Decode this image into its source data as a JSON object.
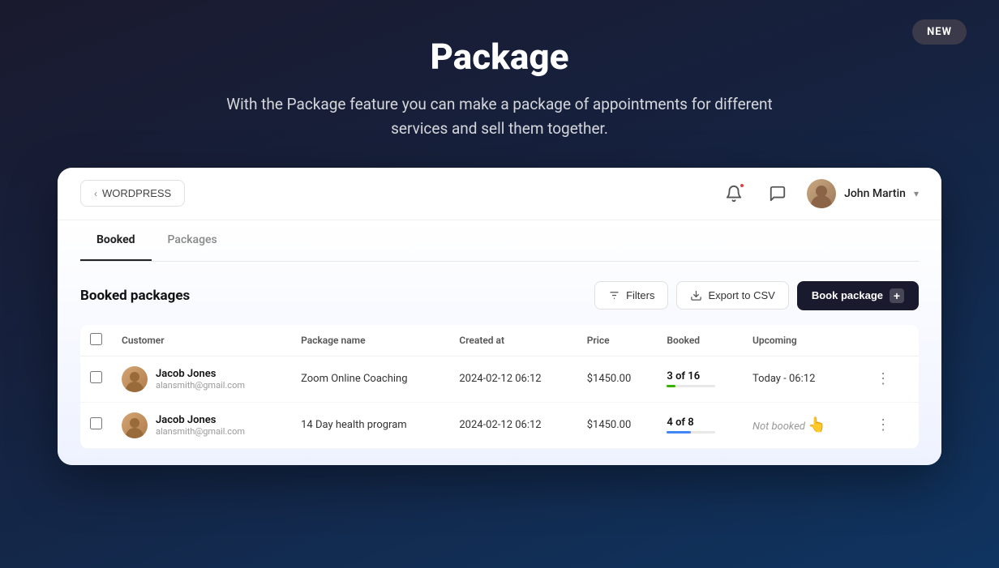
{
  "badge": {
    "label": "NEW"
  },
  "hero": {
    "title": "Package",
    "subtitle": "With the Package feature you can make a package of appointments for different services and sell them together."
  },
  "topbar": {
    "back_button": "WORDPRESS",
    "user_name": "John Martin",
    "chevron": "▾"
  },
  "tabs": [
    {
      "label": "Booked",
      "active": true
    },
    {
      "label": "Packages",
      "active": false
    }
  ],
  "table": {
    "title": "Booked packages",
    "actions": {
      "filters": "Filters",
      "export": "Export to CSV",
      "book": "Book package",
      "book_plus": "+"
    },
    "columns": [
      "Customer",
      "Package name",
      "Created at",
      "Price",
      "Booked",
      "Upcoming"
    ],
    "rows": [
      {
        "customer_name": "Jacob Jones",
        "customer_email": "alansmith@gmail.com",
        "package_name": "Zoom Online Coaching",
        "created_at": "2024-02-12 06:12",
        "price": "$1450.00",
        "booked": "3 of 16",
        "booked_progress": 18,
        "upcoming": "Today - 06:12",
        "progress_color": "green"
      },
      {
        "customer_name": "Jacob Jones",
        "customer_email": "alansmith@gmail.com",
        "package_name": "14 Day health program",
        "created_at": "2024-02-12 06:12",
        "price": "$1450.00",
        "booked": "4 of 8",
        "booked_progress": 50,
        "upcoming": "Not booked",
        "progress_color": "blue"
      }
    ]
  },
  "icons": {
    "bell": "bell-icon",
    "chat": "chat-icon",
    "filters": "filters-icon",
    "download": "download-icon",
    "plus": "plus-icon",
    "more": "⋮",
    "back_chevron": "‹"
  }
}
